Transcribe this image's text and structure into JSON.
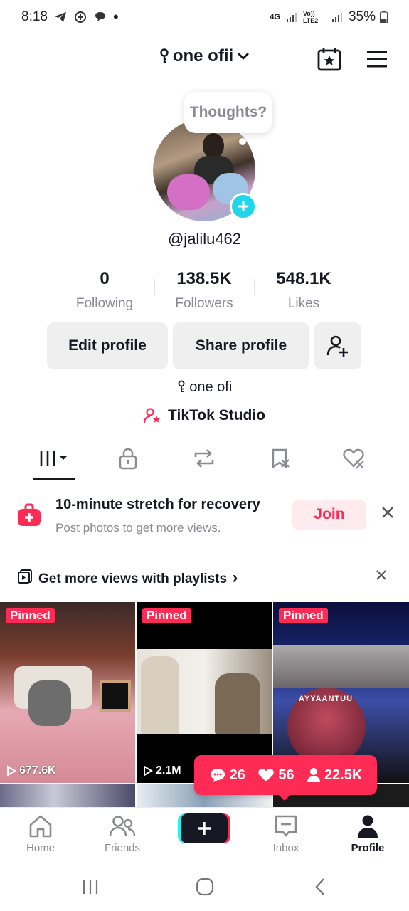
{
  "status_bar": {
    "time": "8:18",
    "network": "4G",
    "volte": "Vo)) LTE2",
    "battery": "35%"
  },
  "header": {
    "account_name": "one ofii"
  },
  "profile": {
    "thought_prompt": "Thoughts?",
    "username": "@jalilu462",
    "bio": "one ofi",
    "studio_link": "TikTok Studio"
  },
  "stats": [
    {
      "value": "0",
      "label": "Following"
    },
    {
      "value": "138.5K",
      "label": "Followers"
    },
    {
      "value": "548.1K",
      "label": "Likes"
    }
  ],
  "buttons": {
    "edit_profile": "Edit profile",
    "share_profile": "Share profile"
  },
  "tabs": [
    {
      "icon": "videos-grid-icon",
      "active": true
    },
    {
      "icon": "lock-icon",
      "active": false
    },
    {
      "icon": "repost-icon",
      "active": false
    },
    {
      "icon": "favorites-icon",
      "active": false
    },
    {
      "icon": "liked-icon",
      "active": false
    }
  ],
  "challenge": {
    "title": "10-minute stretch for recovery",
    "subtitle": "Post photos to get more views.",
    "join_label": "Join"
  },
  "playlist_banner": {
    "text": "Get more views with playlists",
    "chevron": "›"
  },
  "videos": [
    {
      "pinned_label": "Pinned",
      "views": "677.6K"
    },
    {
      "pinned_label": "Pinned",
      "views": "2.1M"
    },
    {
      "pinned_label": "Pinned",
      "views": "",
      "overlay_text": "AYYAANTUU"
    }
  ],
  "engagement": {
    "comments": "26",
    "likes": "56",
    "followers": "22.5K"
  },
  "bottom_nav": [
    {
      "label": "Home",
      "icon": "home-icon",
      "active": false
    },
    {
      "label": "Friends",
      "icon": "friends-icon",
      "active": false
    },
    {
      "label": "",
      "icon": "create-icon",
      "active": false
    },
    {
      "label": "Inbox",
      "icon": "inbox-icon",
      "active": false
    },
    {
      "label": "Profile",
      "icon": "profile-icon",
      "active": true
    }
  ],
  "colors": {
    "brand_red": "#fe2c55",
    "brand_cyan": "#25f4ee",
    "text_dark": "#161823",
    "text_muted": "#8a8b91"
  }
}
